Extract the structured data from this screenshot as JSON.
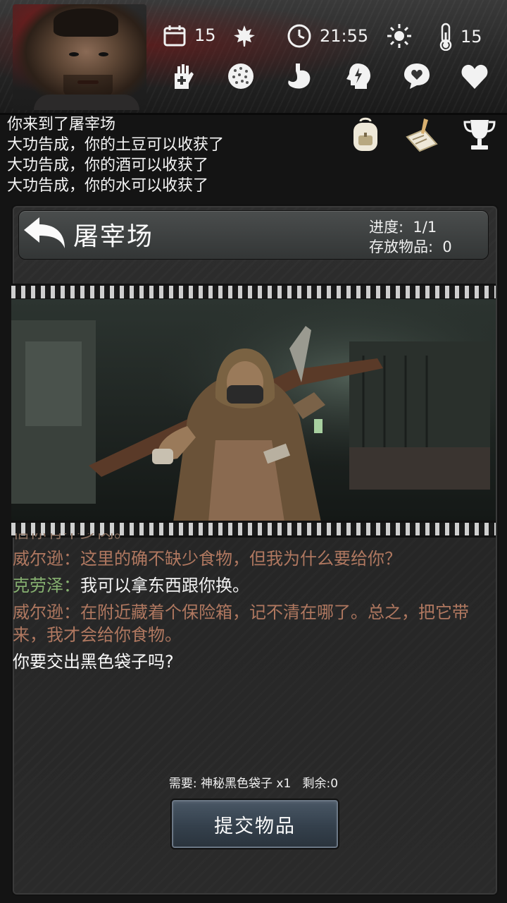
{
  "status": {
    "day": "15",
    "time": "21:55",
    "temperature": "15"
  },
  "log": [
    "你来到了屠宰场",
    "大功告成，你的土豆可以收获了",
    "大功告成，你的酒可以收获了",
    "大功告成，你的水可以收获了"
  ],
  "location": {
    "title": "屠宰场",
    "progress_label": "进度:  1/1",
    "storage_label": "存放物品:  0"
  },
  "dialogue": {
    "clipped_line": "信你有不少肉。",
    "lines": [
      {
        "speaker": "威尔逊",
        "sep": "：",
        "text": "这里的确不缺少食物，但我为什么要给你？"
      },
      {
        "speaker": "克劳泽",
        "sep": "：",
        "text": "我可以拿东西跟你换。"
      },
      {
        "speaker": "威尔逊",
        "sep": "：",
        "text": "在附近藏着个保险箱，记不清在哪了。总之，把它带来，我才会给你食物。"
      }
    ],
    "question": "你要交出黑色袋子吗?"
  },
  "requirement": {
    "need_label": "需要:",
    "item": "神秘黑色袋子 x1",
    "remaining_label": "剩余:",
    "remaining": "0"
  },
  "submit_label": "提交物品",
  "colors": {
    "speaker_wilson": "#b07860",
    "speaker_klauser": "#86b070",
    "button_bg": "#3a4652"
  }
}
